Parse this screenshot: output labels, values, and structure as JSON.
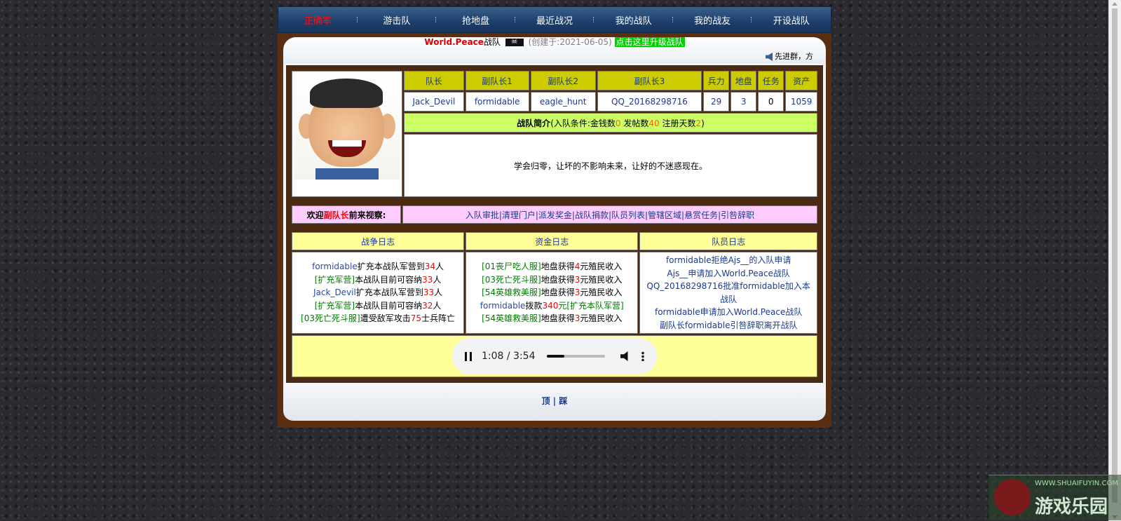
{
  "nav": {
    "items": [
      "正确率",
      "游击队",
      "抢地盘",
      "最近战况",
      "我的战队",
      "我的战友",
      "开设战队"
    ],
    "active_index": 0
  },
  "header": {
    "team_name": "World.Peace",
    "team_suffix": "战队",
    "created": "(创建于:2021-06-05)",
    "upgrade_link": "点击这里升级战队",
    "marquee": "先进群，方"
  },
  "roster": {
    "columns": [
      "队长",
      "副队长1",
      "副队长2",
      "副队长3",
      "兵力",
      "地盘",
      "任务",
      "资产"
    ],
    "values": [
      "Jack_Devil",
      "formidable",
      "eagle_hunt",
      "QQ_20168298716",
      "29",
      "3",
      "0",
      "1059"
    ]
  },
  "intro": {
    "title": "战队简介",
    "cond_prefix": "(入队条件:金钱数",
    "money": "0",
    "posts_label": " 发帖数",
    "posts": "40",
    "days_label": " 注册天数",
    "days": "2",
    "cond_suffix": ")",
    "text": "学会归零，让坏的不影响未来，让好的不迷惑现在。"
  },
  "welcome": {
    "prefix": "欢迎",
    "role": "副队长",
    "suffix": "前来视察:",
    "links": "入队审批|清理门户|派发奖金|战队捐款|队员列表|管辖区域|悬赏任务|引咎辞职"
  },
  "logs": {
    "war_title": "战争日志",
    "fund_title": "资金日志",
    "member_title": "队员日志",
    "war": [
      {
        "a": "formidable",
        "b": "扩充本战队军营到",
        "n": "34",
        "c": "人"
      },
      {
        "a": "[扩充军营]",
        "b": "本战队目前可容纳",
        "n": "33",
        "c": "人"
      },
      {
        "a": "Jack_Devil",
        "b": "扩充本战队军营到",
        "n": "33",
        "c": "人"
      },
      {
        "a": "[扩充军营]",
        "b": "本战队目前可容纳",
        "n": "32",
        "c": "人"
      },
      {
        "a": "[03死亡死斗服]",
        "b": "遭受敌军攻击",
        "n": "75",
        "c": "士兵阵亡"
      }
    ],
    "fund": [
      {
        "a": "[01丧尸吃人服]",
        "b": "地盘获得",
        "n": "4",
        "c": "元殖民收入"
      },
      {
        "a": "[03死亡死斗服]",
        "b": "地盘获得",
        "n": "3",
        "c": "元殖民收入"
      },
      {
        "a": "[54英雄救美服]",
        "b": "地盘获得",
        "n": "3",
        "c": "元殖民收入"
      },
      {
        "a": "formidable",
        "b": "拨款",
        "n": "340",
        "c": "元[扩充本队军营]"
      },
      {
        "a": "[54英雄救美服]",
        "b": "地盘获得",
        "n": "3",
        "c": "元殖民收入"
      }
    ],
    "member": [
      "formidable拒绝Ajs__的入队申请",
      "Ajs__申请加入World.Peace战队",
      "QQ_20168298716批准formidable加入本战队",
      "formidable申请加入World.Peace战队",
      "副队长formidable引咎辞职离开战队"
    ]
  },
  "player": {
    "time": "1:08 / 3:54",
    "progress_fraction": 0.3
  },
  "footer": {
    "top": "顶",
    "sep": " | ",
    "bottom": "踩"
  },
  "watermark": {
    "small": "WWW.SHUAIFUYIN.COM",
    "big": "游戏乐园"
  }
}
